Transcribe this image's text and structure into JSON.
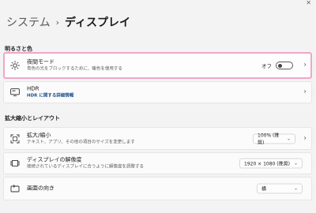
{
  "window": {
    "close_glyph": "✕"
  },
  "breadcrumb": {
    "parent": "システム",
    "separator": "›",
    "current": "ディスプレイ"
  },
  "sections": {
    "brightness_color": "明るさと色",
    "scale_layout": "拡大縮小とレイアウト"
  },
  "night_light": {
    "title": "夜間モード",
    "desc": "青色の光をブロックするために、暖色を使用する",
    "state_label": "オフ",
    "icon": "brightness-icon"
  },
  "hdr": {
    "title": "HDR",
    "link": "HDR に関する詳細情報",
    "icon": "hdr-icon"
  },
  "scale": {
    "title": "拡大/縮小",
    "desc": "テキスト、アプリ、その他の項目のサイズを変更します",
    "value": "100% (推奨)",
    "icon": "scale-icon"
  },
  "resolution": {
    "title": "ディスプレイの解像度",
    "desc": "接続されているディスプレイに合うように解像度を調整する",
    "value": "1920 × 1080 (推奨)",
    "icon": "resolution-icon"
  },
  "orientation": {
    "title": "画面の向き",
    "value": "横",
    "icon": "orientation-icon"
  },
  "colors": {
    "highlight": "#f0a6c8",
    "link": "#1a4f8c"
  }
}
